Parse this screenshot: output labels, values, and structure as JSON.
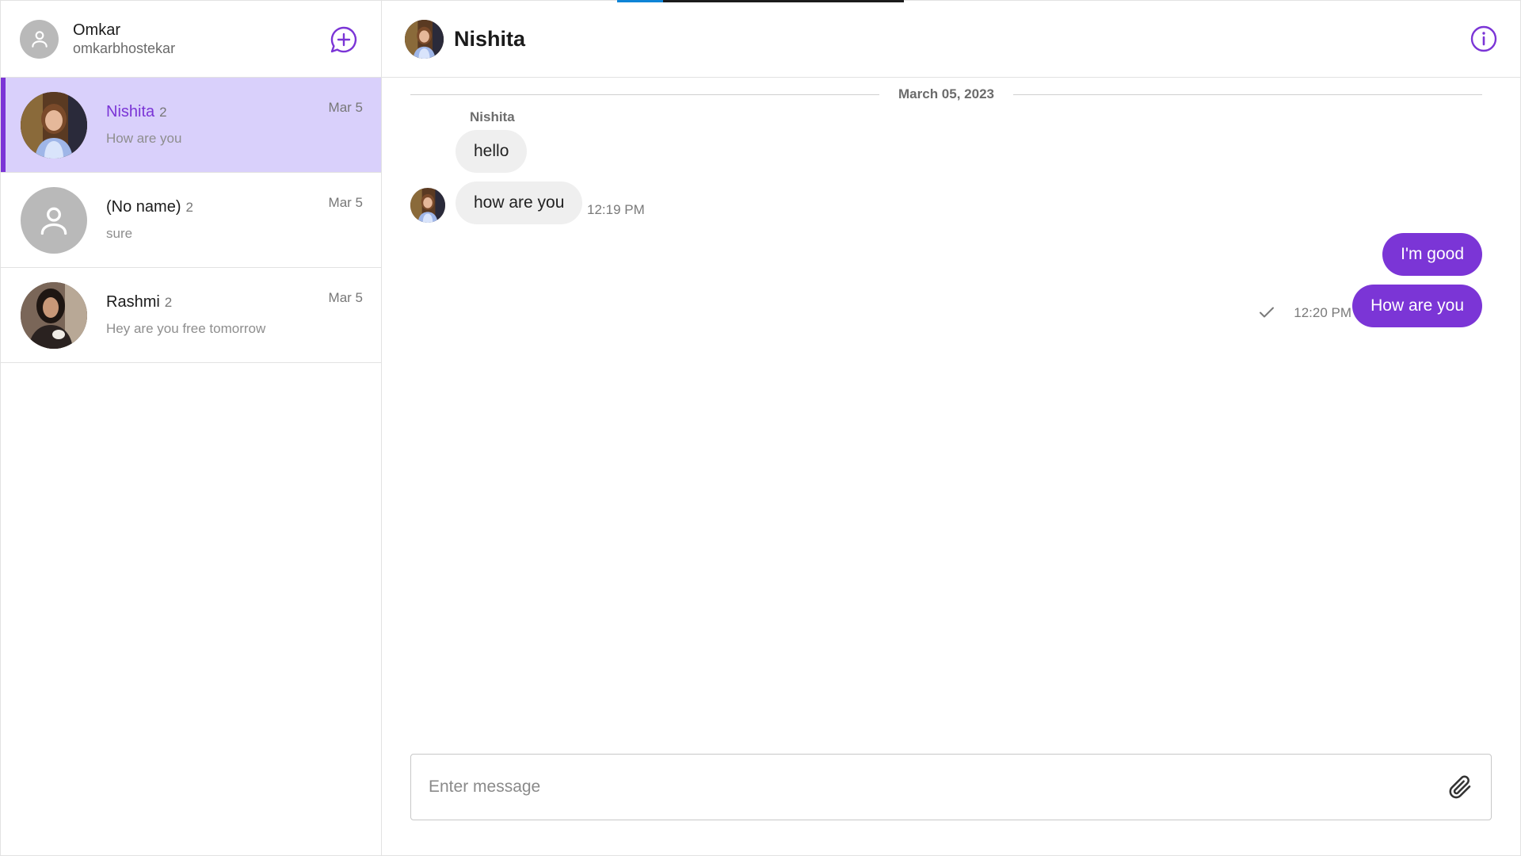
{
  "current_user": {
    "name": "Omkar",
    "handle": "omkarbhostekar"
  },
  "conversations": [
    {
      "name": "Nishita",
      "count": "2",
      "date": "Mar 5",
      "preview": "How are you",
      "avatar": "photo-woman-smiling",
      "active": true
    },
    {
      "name": "(No name)",
      "count": "2",
      "date": "Mar 5",
      "preview": "sure",
      "avatar": "user-placeholder",
      "active": false
    },
    {
      "name": "Rashmi",
      "count": "2",
      "date": "Mar 5",
      "preview": "Hey are you free tomorrow",
      "avatar": "photo-woman-dark-hair",
      "active": false
    }
  ],
  "chat": {
    "title": "Nishita",
    "date_divider": "March 05, 2023",
    "sender_label": "Nishita",
    "messages": [
      {
        "direction": "in",
        "text": "hello",
        "time": ""
      },
      {
        "direction": "in",
        "text": "how are you",
        "time": "12:19 PM"
      },
      {
        "direction": "out",
        "text": "I'm good",
        "time": ""
      },
      {
        "direction": "out",
        "text": "How are you",
        "time": "12:20 PM",
        "status": "sent-check"
      }
    ],
    "composer_placeholder": "Enter message"
  },
  "colors": {
    "accent": "#7b35d6",
    "active_bg": "#d9d0fb",
    "progress": "#0f84d6"
  },
  "progress": {
    "value": 0.16
  }
}
